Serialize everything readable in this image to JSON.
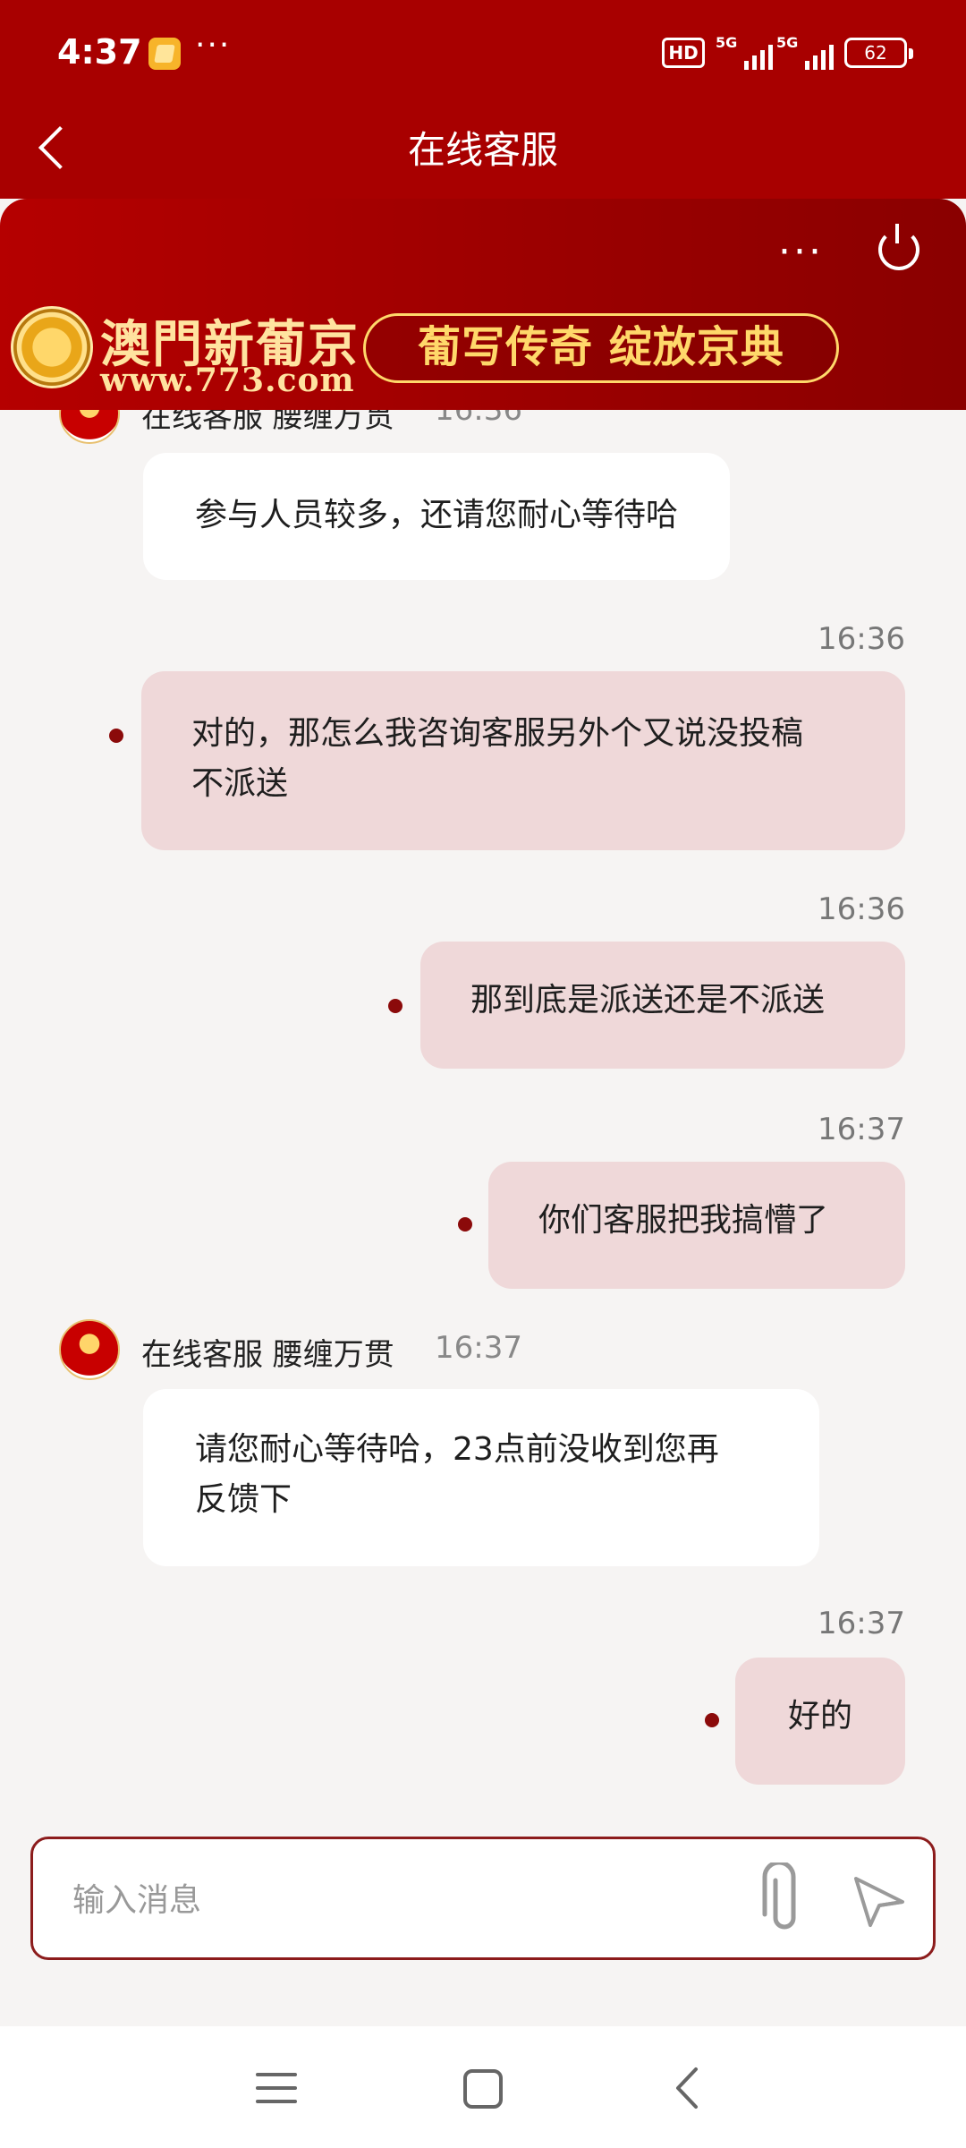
{
  "status_bar": {
    "time": "4:37",
    "more": "···",
    "hd_label": "HD",
    "signal1_label": "5G",
    "signal2_label": "5G",
    "battery": "62"
  },
  "header": {
    "title": "在线客服",
    "back_icon": "chevron-left-icon"
  },
  "banner": {
    "more": "···",
    "power_icon": "power-icon",
    "brand_name": "澳門新葡京",
    "brand_url": "www.773.com",
    "slogan": "葡写传奇 绽放京典"
  },
  "messages": {
    "m1": {
      "sender": "在线客服 腰缠万贯",
      "time": "16:36",
      "text": "参与人员较多，还请您耐心等待哈"
    },
    "m2": {
      "time": "16:36",
      "line1": "对的，那怎么我咨询客服另外个又说没投稿",
      "line2": "不派送"
    },
    "m3": {
      "time": "16:36",
      "text": "那到底是派送还是不派送"
    },
    "m4": {
      "time": "16:37",
      "text": "你们客服把我搞懵了"
    },
    "m5": {
      "sender": "在线客服 腰缠万贯",
      "time": "16:37",
      "line1": "请您耐心等待哈，23点前没收到您再",
      "line2": "反馈下"
    },
    "m6": {
      "time": "16:37",
      "text": "好的"
    }
  },
  "composer": {
    "placeholder": "输入消息",
    "value": "",
    "attach_icon": "paperclip-icon",
    "send_icon": "send-icon"
  },
  "colors": {
    "header_bg": "#a80000",
    "outgoing_bubble": "#efd8d9",
    "incoming_bubble": "#ffffff",
    "chat_bg": "#f6f4f3",
    "dot": "#8b0a0a"
  }
}
